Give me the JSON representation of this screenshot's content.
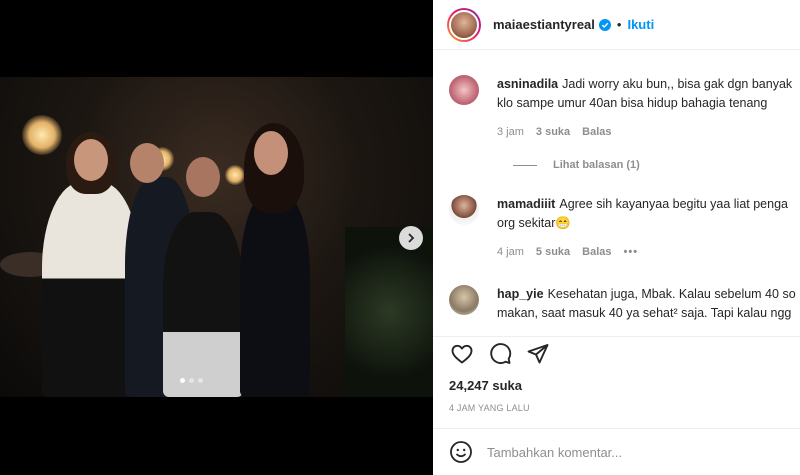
{
  "post": {
    "username": "maiaestiantyreal",
    "follow_label": "Ikuti",
    "separator": "•",
    "carousel": {
      "slides": 3,
      "active": 1
    }
  },
  "comments": [
    {
      "user": "asninadila",
      "line1": "Jadi worry aku bun,, bisa gak dgn banyak",
      "line2": "klo sampe umur 40an bisa hidup bahagia tenang",
      "time": "3 jam",
      "likes": "3 suka",
      "reply": "Balas",
      "view_replies": "Lihat balasan (1)"
    },
    {
      "user": "mamadiiit",
      "line1": "Agree sih kayanyaa begitu yaa liat penga",
      "line2": "org sekitar😁",
      "time": "4 jam",
      "likes": "5 suka",
      "reply": "Balas",
      "more": "•••"
    },
    {
      "user": "hap_yie",
      "line1": "Kesehatan juga, Mbak. Kalau sebelum 40 so",
      "line2": "makan, saat masuk 40 ya sehat² saja. Tapi kalau ngg"
    }
  ],
  "stats": {
    "likes": "24,247 suka",
    "posted": "4 JAM YANG LALU"
  },
  "comment_input": {
    "placeholder": "Tambahkan komentar..."
  },
  "icons": {
    "like": "heart-icon",
    "comment": "comment-icon",
    "share": "share-icon",
    "emoji": "emoji-icon",
    "verified": "verified-badge-icon",
    "next": "chevron-right-icon"
  },
  "colors": {
    "accent": "#0095f6",
    "text": "#262626",
    "muted": "#8e8e8e"
  }
}
